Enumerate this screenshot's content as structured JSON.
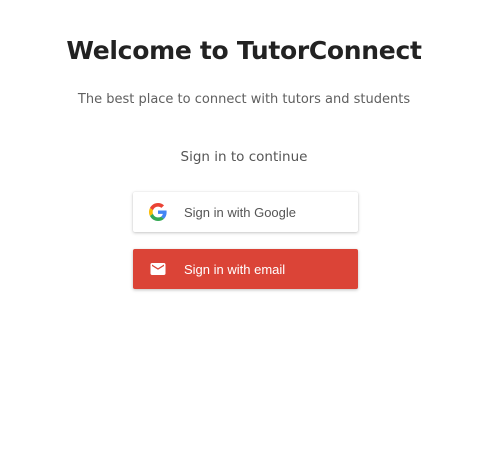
{
  "header": {
    "title": "Welcome to TutorConnect",
    "subtitle": "The best place to connect with tutors and students"
  },
  "signin": {
    "heading": "Sign in to continue",
    "google_label": "Sign in with Google",
    "google_icon": "google-icon",
    "email_label": "Sign in with email",
    "email_icon": "mail-icon"
  },
  "colors": {
    "email_button": "#db4437",
    "title_text": "#222222"
  }
}
